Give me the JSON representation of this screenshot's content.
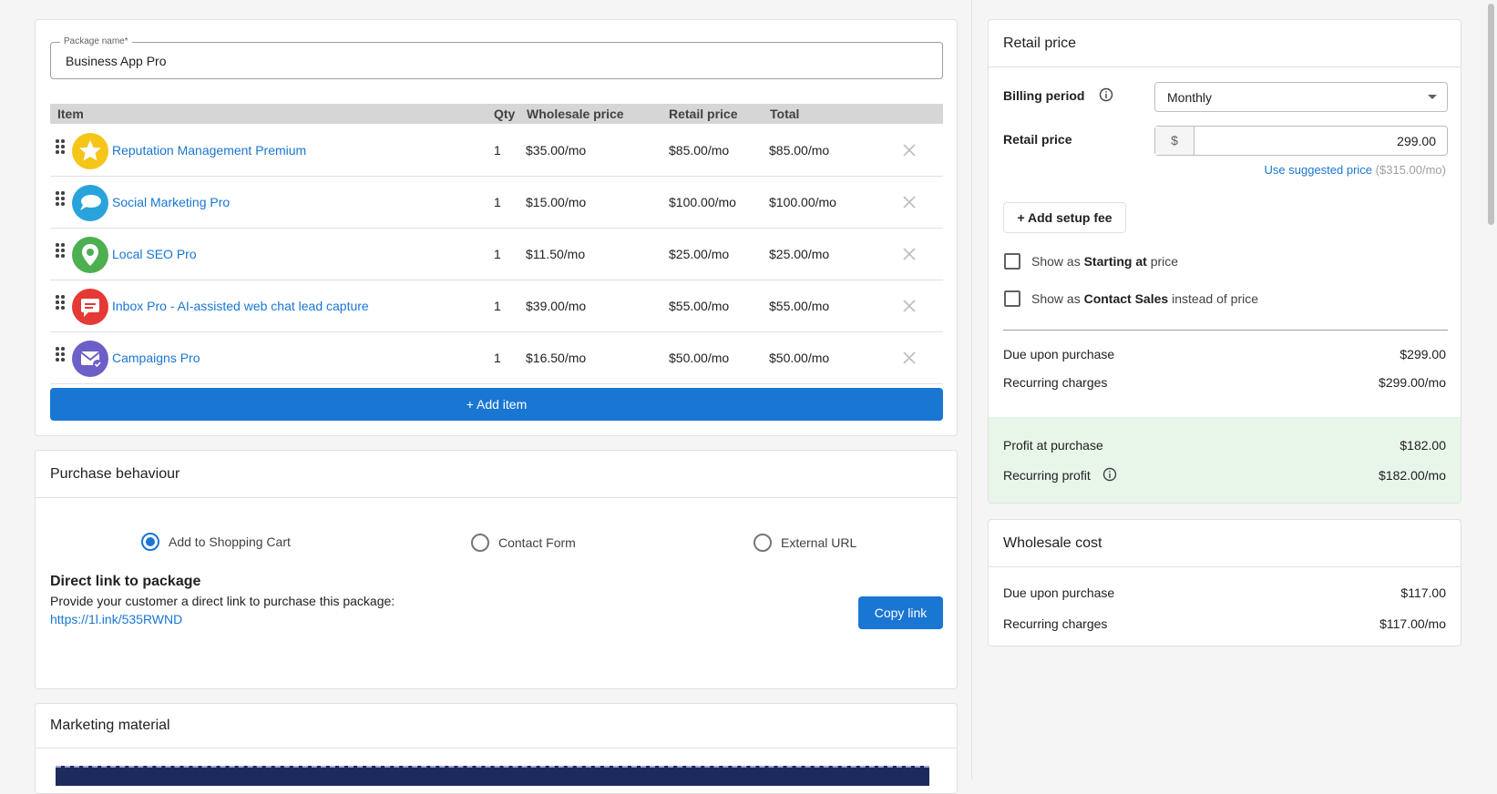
{
  "package": {
    "name_label": "Package name*",
    "name_value": "Business App Pro"
  },
  "table": {
    "headers": {
      "item": "Item",
      "qty": "Qty",
      "wholesale": "Wholesale price",
      "retail": "Retail price",
      "total": "Total"
    },
    "rows": [
      {
        "name": "Reputation Management Premium",
        "qty": "1",
        "wholesale": "$35.00/mo",
        "retail": "$85.00/mo",
        "total": "$85.00/mo",
        "icon": "star-icon",
        "color": "#f5c518"
      },
      {
        "name": "Social Marketing Pro",
        "qty": "1",
        "wholesale": "$15.00/mo",
        "retail": "$100.00/mo",
        "total": "$100.00/mo",
        "icon": "chat-bubble-icon",
        "color": "#29a3dc"
      },
      {
        "name": "Local SEO Pro",
        "qty": "1",
        "wholesale": "$11.50/mo",
        "retail": "$25.00/mo",
        "total": "$25.00/mo",
        "icon": "map-pin-icon",
        "color": "#4caf50"
      },
      {
        "name": "Inbox Pro - AI-assisted web chat lead capture",
        "qty": "1",
        "wholesale": "$39.00/mo",
        "retail": "$55.00/mo",
        "total": "$55.00/mo",
        "icon": "message-icon",
        "color": "#e53935"
      },
      {
        "name": "Campaigns Pro",
        "qty": "1",
        "wholesale": "$16.50/mo",
        "retail": "$50.00/mo",
        "total": "$50.00/mo",
        "icon": "envelope-check-icon",
        "color": "#6c5fc7"
      }
    ],
    "add_item_label": "+ Add item"
  },
  "purchase": {
    "title": "Purchase behaviour",
    "options": [
      "Add to Shopping Cart",
      "Contact Form",
      "External URL"
    ],
    "selected": "Add to Shopping Cart",
    "direct_link_title": "Direct link to package",
    "direct_link_desc": "Provide your customer a direct link to purchase this package:",
    "direct_link_url": "https://1l.ink/535RWND",
    "copy_label": "Copy link"
  },
  "marketing": {
    "title": "Marketing material"
  },
  "retail": {
    "title": "Retail price",
    "billing_label": "Billing period",
    "billing_value": "Monthly",
    "price_label": "Retail price",
    "currency": "$",
    "price_value": "299.00",
    "suggested_link": "Use suggested price",
    "suggested_value": "($315.00/mo)",
    "setup_fee_label": "+ Add setup fee",
    "starting_prefix": "Show as",
    "starting_bold": "Starting at",
    "starting_suffix": "price",
    "contact_prefix": "Show as",
    "contact_bold": "Contact Sales",
    "contact_suffix": "instead of price",
    "due_label": "Due upon purchase",
    "due_value": "$299.00",
    "recurring_label": "Recurring charges",
    "recurring_value": "$299.00/mo",
    "profit_label": "Profit at purchase",
    "profit_value": "$182.00",
    "recurring_profit_label": "Recurring profit",
    "recurring_profit_value": "$182.00/mo",
    "accent": "#1976d2",
    "profit_bg": "#e8f5e9"
  },
  "wholesale": {
    "title": "Wholesale cost",
    "due_label": "Due upon purchase",
    "due_value": "$117.00",
    "recurring_label": "Recurring charges",
    "recurring_value": "$117.00/mo"
  }
}
